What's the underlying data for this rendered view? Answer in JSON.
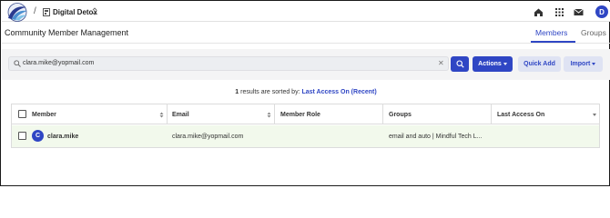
{
  "header": {
    "workspace_name": "Digital Detox",
    "breadcrumb_separator": "/",
    "user_initial": "D",
    "icons": [
      "home-icon",
      "apps-grid-icon",
      "mail-icon"
    ]
  },
  "page": {
    "title": "Community Member Management",
    "tabs": [
      {
        "label": "Members",
        "active": true
      },
      {
        "label": "Groups",
        "active": false
      }
    ]
  },
  "toolbar": {
    "search_value": "clara.mike@yopmail.com",
    "clear_symbol": "✕",
    "actions_label": "Actions",
    "quick_add_label": "Quick Add",
    "import_label": "Import"
  },
  "results": {
    "count": "1",
    "text": " results are sorted by: ",
    "sort_field": "Last Access On (Recent)"
  },
  "table": {
    "columns": [
      "Member",
      "Email",
      "Member Role",
      "Groups",
      "Last Access On"
    ],
    "rows": [
      {
        "avatar_initial": "C",
        "member": "clara.mike",
        "email": "clara.mike@yopmail.com",
        "role": "",
        "groups": "email and auto | Mindful Tech L...",
        "last_access": ""
      }
    ]
  },
  "colors": {
    "accent": "#2f46c4",
    "row_highlight": "#f2f9ec",
    "toolbar_bg": "#f4f4f5"
  }
}
